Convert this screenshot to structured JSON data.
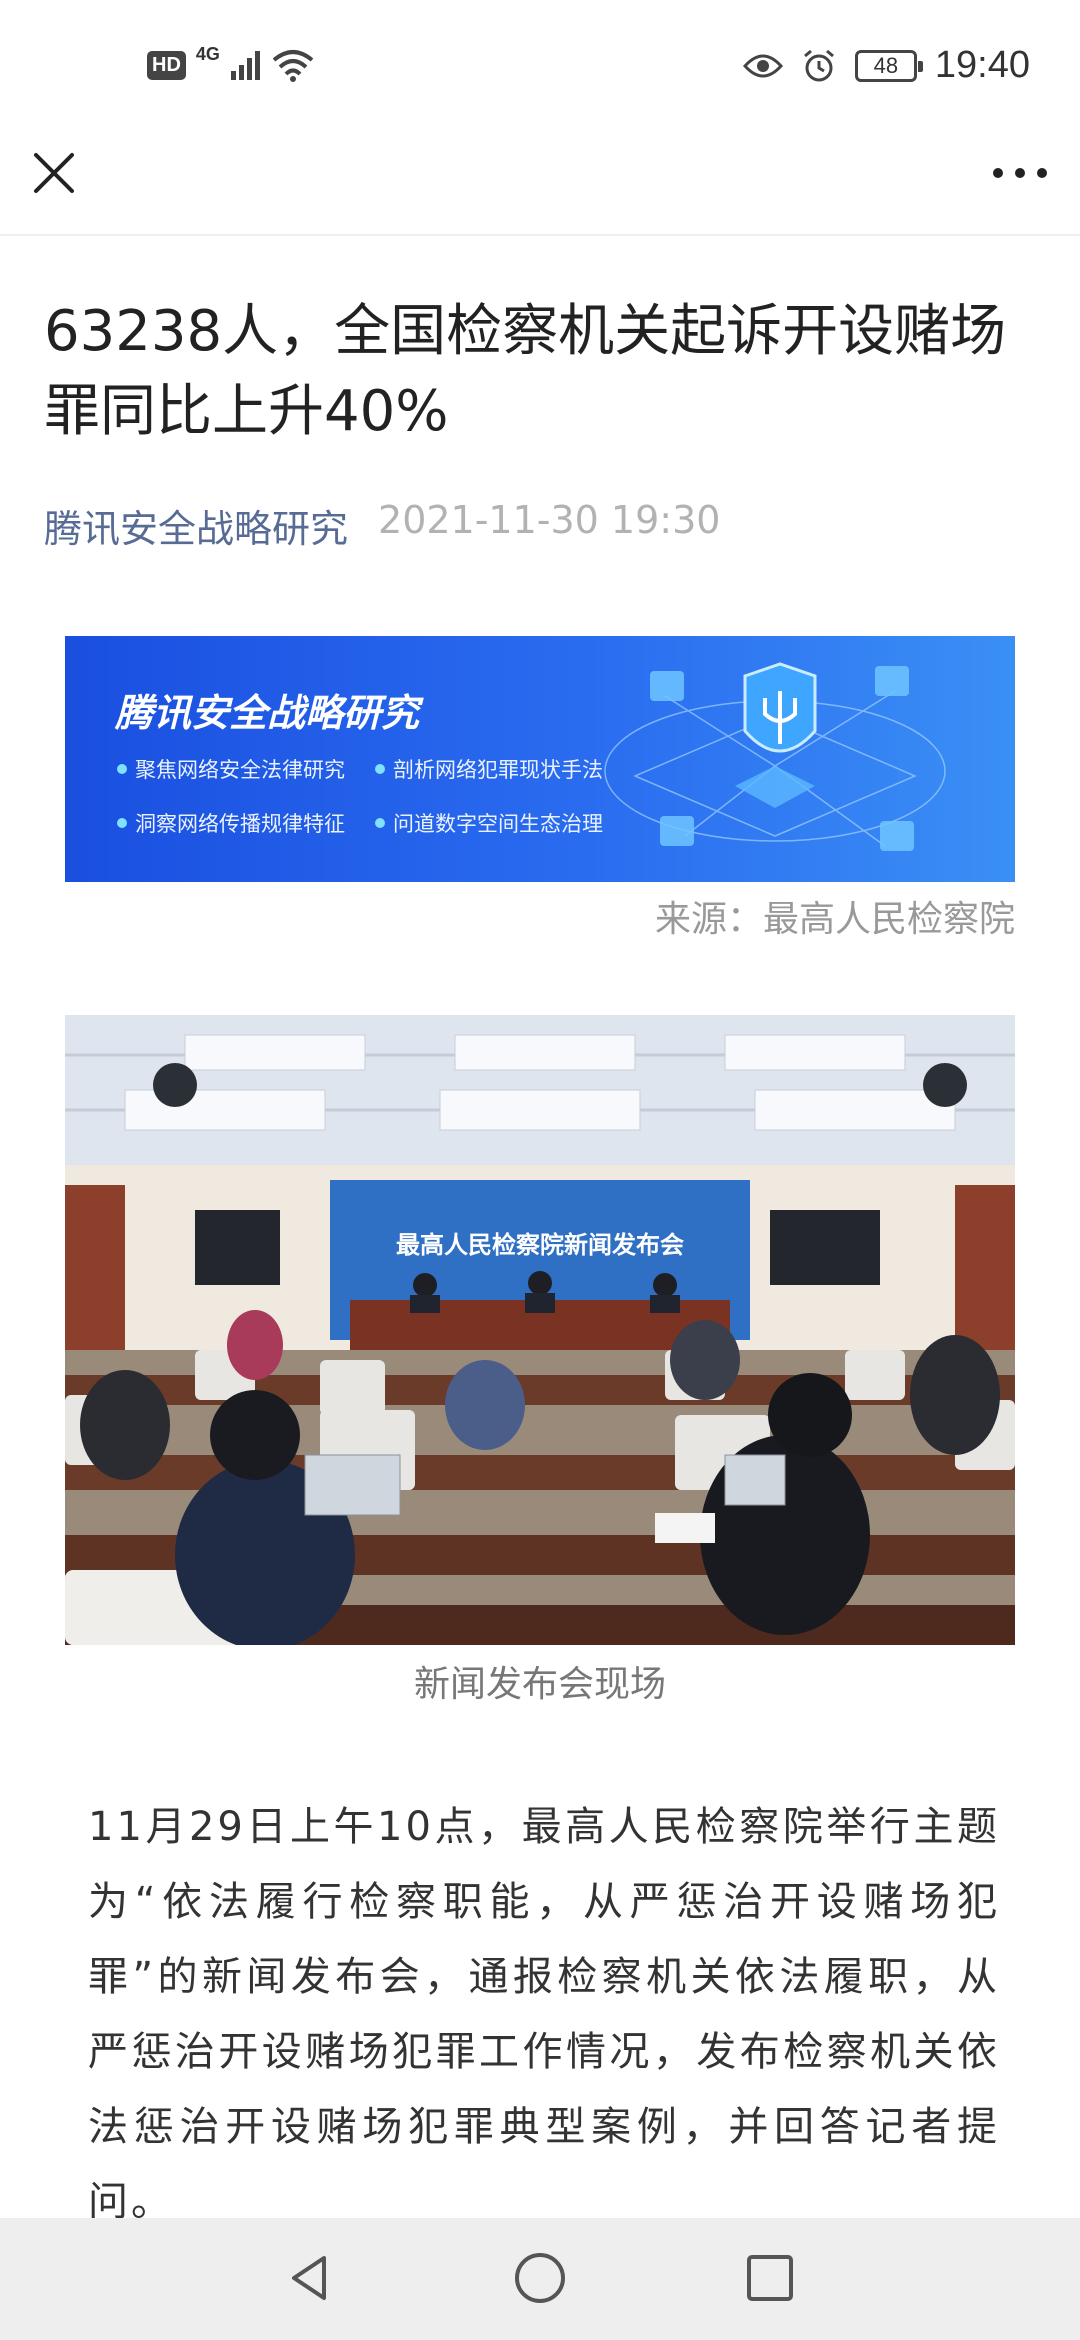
{
  "status_bar": {
    "hd": "HD",
    "network": "4G",
    "battery": "48",
    "time": "19:40"
  },
  "toolbar": {
    "close_icon": "close-icon",
    "more_icon": "more-dots-icon"
  },
  "article": {
    "title": "63238人，全国检察机关起诉开设赌场罪同比上升40%",
    "account": "腾讯安全战略研究",
    "date": "2021-11-30 19:30"
  },
  "banner": {
    "title": "腾讯安全战略研究",
    "items": [
      "聚焦网络安全法律研究",
      "剖析网络犯罪现状手法",
      "洞察网络传播规律特征",
      "问道数字空间生态治理"
    ],
    "caption": "来源：最高人民检察院",
    "colors": {
      "start": "#1a4fe0",
      "end": "#3a8ff5"
    }
  },
  "photo": {
    "backdrop_text": "最高人民检察院新闻发布会",
    "caption": "新闻发布会现场"
  },
  "body": {
    "paragraph": "11月29日上午10点，最高人民检察院举行主题为“依法履行检察职能，从严惩治开设赌场犯罪”的新闻发布会，通报检察机关依法履职，从严惩治开设赌场犯罪工作情况，发布检察机关依法惩治开设赌场犯罪典型案例，并回答记者提问。"
  },
  "nav": {
    "back_icon": "back-triangle-icon",
    "home_icon": "home-circle-icon",
    "recents_icon": "recents-square-icon"
  }
}
